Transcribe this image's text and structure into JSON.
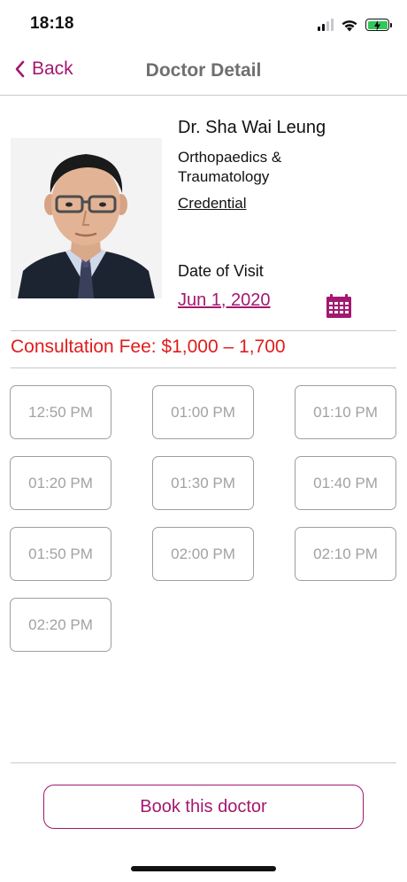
{
  "status_bar": {
    "time": "18:18",
    "battery_color": "#31c759",
    "signal_bars_active": 2,
    "signal_bars_total": 4
  },
  "nav": {
    "back_label": "Back",
    "title": "Doctor Detail",
    "accent_color": "#a31870"
  },
  "doctor": {
    "name": "Dr. Sha Wai Leung",
    "specialty_line1": "Orthopaedics &",
    "specialty_line2": "Traumatology",
    "credential_label": "Credential",
    "photo_icon": "doctor-portrait"
  },
  "visit": {
    "label": "Date of Visit",
    "date": "Jun 1, 2020",
    "calendar_icon": "calendar-icon"
  },
  "fee": {
    "text": "Consultation Fee: $1,000 – 1,700",
    "color": "#e21b1b"
  },
  "slots": [
    "12:50 PM",
    "01:00 PM",
    "01:10 PM",
    "01:20 PM",
    "01:30 PM",
    "01:40 PM",
    "01:50 PM",
    "02:00 PM",
    "02:10 PM",
    "02:20 PM"
  ],
  "booking": {
    "button_label": "Book this doctor"
  }
}
